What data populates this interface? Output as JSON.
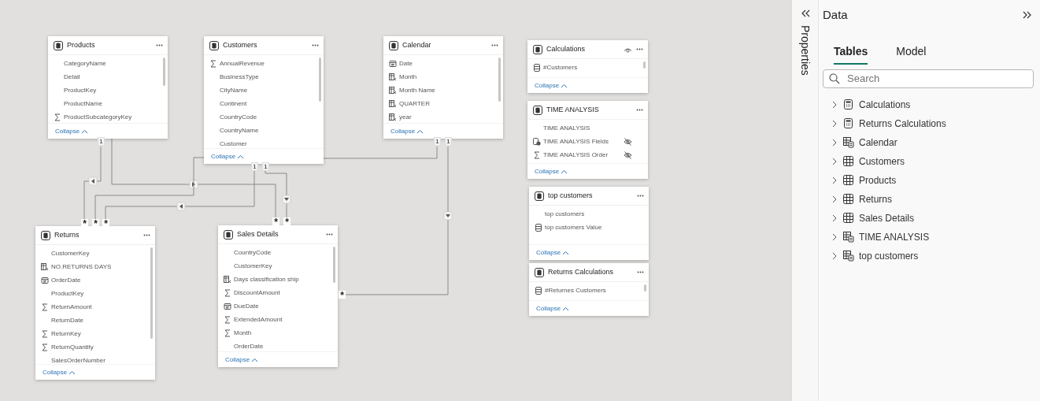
{
  "tables": [
    {
      "title": "Products",
      "header_eye": false,
      "collapse": "Collapse",
      "fields": [
        {
          "name": "CategoryName",
          "kind": "column",
          "hidden": false
        },
        {
          "name": "Detail",
          "kind": "column",
          "hidden": false
        },
        {
          "name": "ProductKey",
          "kind": "column",
          "hidden": false
        },
        {
          "name": "ProductName",
          "kind": "column",
          "hidden": false
        },
        {
          "name": "ProductSubcategoryKey",
          "kind": "sum",
          "hidden": false
        }
      ]
    },
    {
      "title": "Customers",
      "header_eye": false,
      "collapse": "Collapse",
      "fields": [
        {
          "name": "AnnualRevenue",
          "kind": "sum",
          "hidden": false
        },
        {
          "name": "BusinessType",
          "kind": "column",
          "hidden": false
        },
        {
          "name": "CityName",
          "kind": "column",
          "hidden": false
        },
        {
          "name": "Continent",
          "kind": "column",
          "hidden": false
        },
        {
          "name": "CountryCode",
          "kind": "column",
          "hidden": false
        },
        {
          "name": "CountryName",
          "kind": "column",
          "hidden": false
        },
        {
          "name": "Customer",
          "kind": "column",
          "hidden": false
        }
      ]
    },
    {
      "title": "Calendar",
      "header_eye": false,
      "collapse": "Collapse",
      "fields": [
        {
          "name": "Date",
          "kind": "date",
          "hidden": false
        },
        {
          "name": "Month",
          "kind": "calculated",
          "hidden": false
        },
        {
          "name": "Month Name",
          "kind": "calculated",
          "hidden": false
        },
        {
          "name": "QUARTER",
          "kind": "calculated",
          "hidden": false
        },
        {
          "name": "year",
          "kind": "calculated",
          "hidden": false
        }
      ]
    },
    {
      "title": "Calculations",
      "header_eye": true,
      "collapse": "Collapse",
      "fields": [
        {
          "name": "#Customers",
          "kind": "measure",
          "hidden": false
        }
      ]
    },
    {
      "title": "TIME ANALYSIS",
      "header_eye": false,
      "collapse": "Collapse",
      "fields": [
        {
          "name": "TIME ANALYSIS",
          "kind": "column",
          "hidden": false
        },
        {
          "name": "TIME ANALYSIS Fields",
          "kind": "parameter",
          "hidden": true
        },
        {
          "name": "TIME ANALYSIS Order",
          "kind": "sum",
          "hidden": true
        }
      ]
    },
    {
      "title": "top customers",
      "header_eye": false,
      "collapse": "Collapse",
      "fields": [
        {
          "name": "top customers",
          "kind": "column",
          "hidden": false
        },
        {
          "name": "top customers Value",
          "kind": "measure",
          "hidden": false
        }
      ]
    },
    {
      "title": "Returns Calculations",
      "header_eye": false,
      "collapse": "Collapse",
      "fields": [
        {
          "name": "#Returnes Customers",
          "kind": "measure",
          "hidden": false
        }
      ]
    },
    {
      "title": "Returns",
      "header_eye": false,
      "collapse": "Collapse",
      "fields": [
        {
          "name": "CustomerKey",
          "kind": "column",
          "hidden": false
        },
        {
          "name": "NO.RETURNS DAYS",
          "kind": "calculated",
          "hidden": false
        },
        {
          "name": "OrderDate",
          "kind": "date",
          "hidden": false
        },
        {
          "name": "ProductKey",
          "kind": "column",
          "hidden": false
        },
        {
          "name": "ReturnAmount",
          "kind": "sum",
          "hidden": false
        },
        {
          "name": "ReturnDate",
          "kind": "column",
          "hidden": false
        },
        {
          "name": "ReturnKey",
          "kind": "sum",
          "hidden": false
        },
        {
          "name": "ReturnQuantity",
          "kind": "sum",
          "hidden": false
        },
        {
          "name": "SalesOrderNumber",
          "kind": "column",
          "hidden": false
        }
      ]
    },
    {
      "title": "Sales Details",
      "header_eye": false,
      "collapse": "Collapse",
      "fields": [
        {
          "name": "CountryCode",
          "kind": "column",
          "hidden": false
        },
        {
          "name": "CustomerKey",
          "kind": "column",
          "hidden": false
        },
        {
          "name": "Days classification ship",
          "kind": "calculated",
          "hidden": false
        },
        {
          "name": "DiscountAmount",
          "kind": "sum",
          "hidden": false
        },
        {
          "name": "DueDate",
          "kind": "date",
          "hidden": false
        },
        {
          "name": "ExtendedAmount",
          "kind": "sum",
          "hidden": false
        },
        {
          "name": "Month",
          "kind": "sum",
          "hidden": false
        },
        {
          "name": "OrderDate",
          "kind": "column",
          "hidden": false
        }
      ]
    }
  ],
  "relationships": [
    {
      "one_end": "1",
      "many_end": "*"
    },
    {
      "many_end": "*"
    },
    {
      "many_end": "*"
    },
    {
      "one_end": "1",
      "many_end": "*"
    },
    {
      "one_end": "1",
      "many_end": "*"
    },
    {
      "one_end": "1"
    },
    {
      "one_end": "1",
      "many_end": "*"
    }
  ],
  "properties_pane": {
    "title": "Properties"
  },
  "data_pane": {
    "title": "Data",
    "tabs": [
      {
        "label": "Tables",
        "selected": true
      },
      {
        "label": "Model",
        "selected": false
      }
    ],
    "search": {
      "placeholder": "Search"
    },
    "items": [
      {
        "label": "Calculations",
        "kind": "measures",
        "expanded": false
      },
      {
        "label": "Returns Calculations",
        "kind": "measures",
        "expanded": false
      },
      {
        "label": "Calendar",
        "kind": "calculated",
        "expanded": false
      },
      {
        "label": "Customers",
        "kind": "table",
        "expanded": false
      },
      {
        "label": "Products",
        "kind": "table",
        "expanded": false
      },
      {
        "label": "Returns",
        "kind": "table",
        "expanded": false
      },
      {
        "label": "Sales Details",
        "kind": "table",
        "expanded": false
      },
      {
        "label": "TIME ANALYSIS",
        "kind": "calculated",
        "expanded": false
      },
      {
        "label": "top customers",
        "kind": "calculated",
        "expanded": false
      }
    ]
  }
}
